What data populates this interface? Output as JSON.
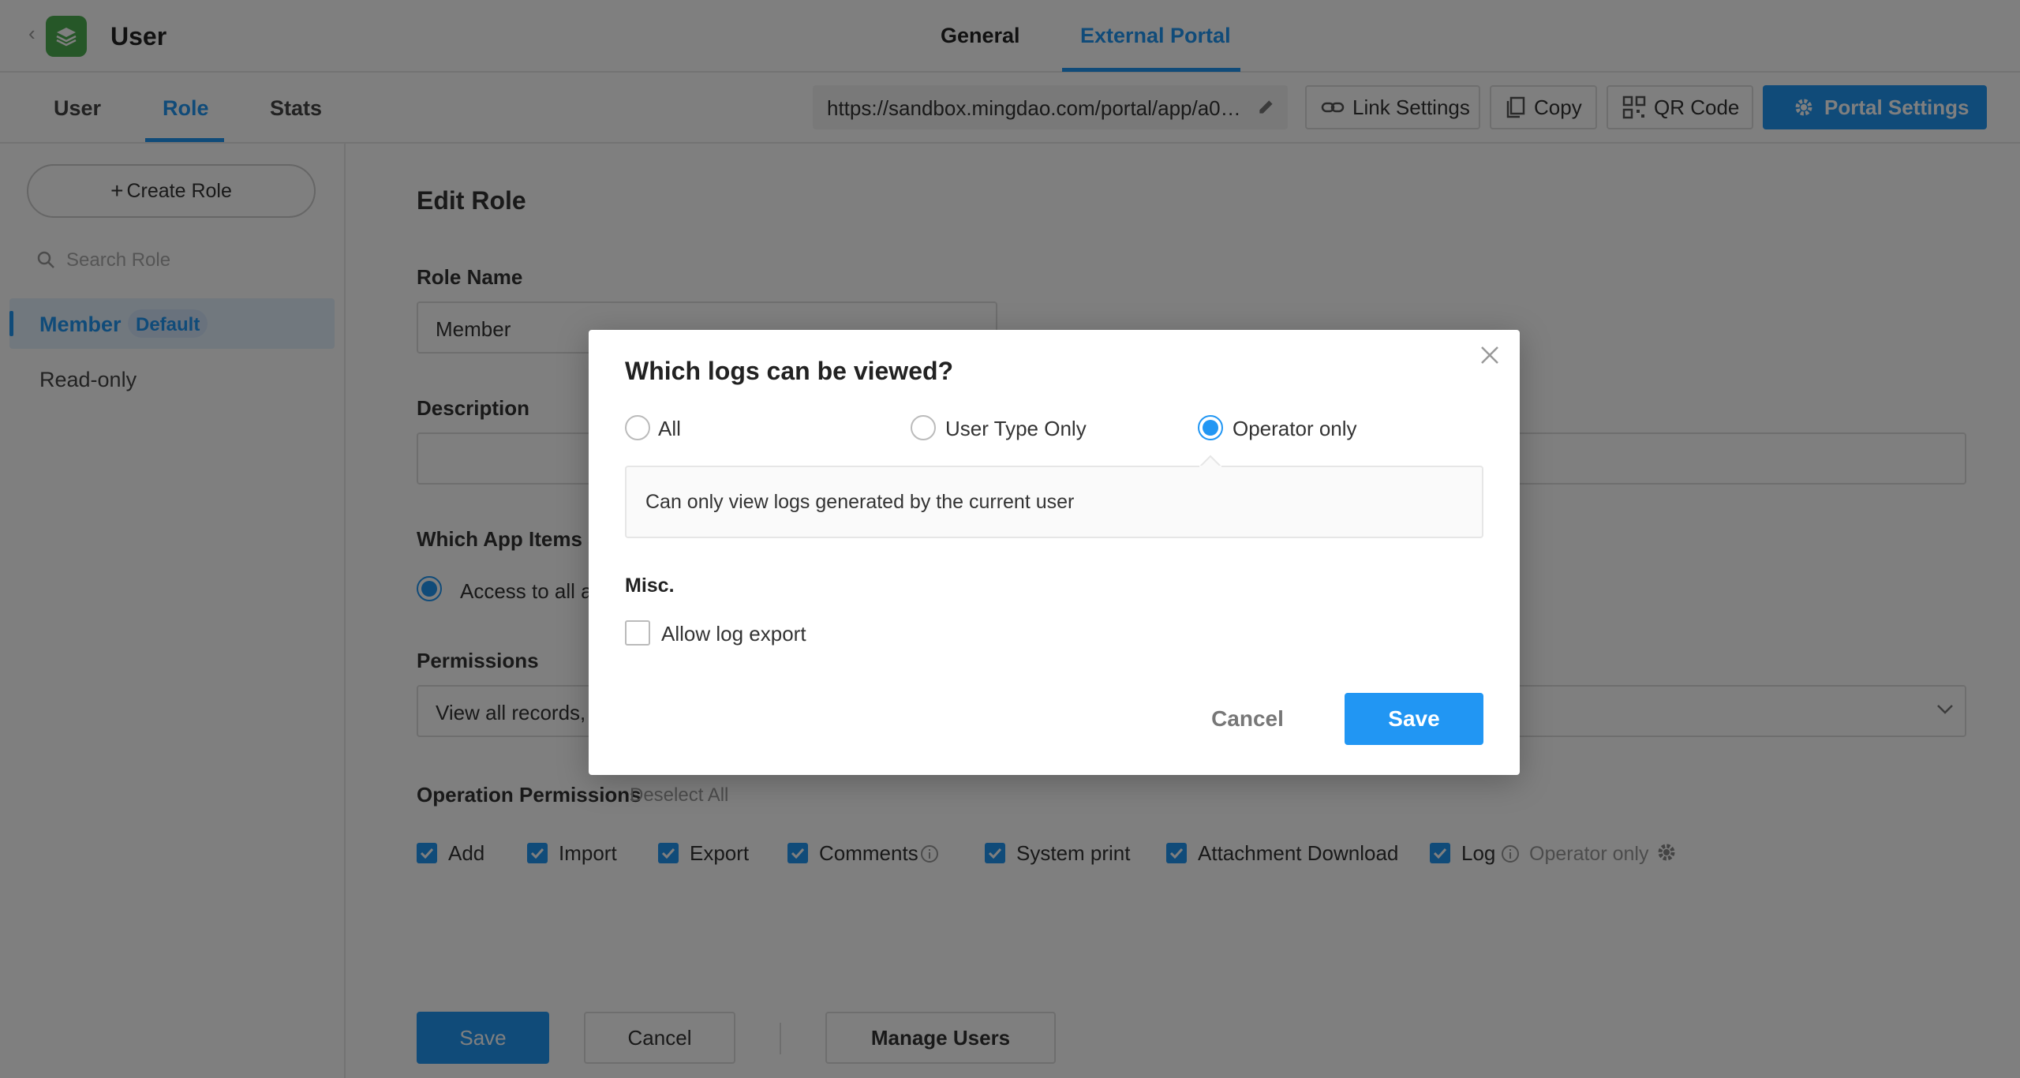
{
  "header": {
    "app_title": "User",
    "tabs": [
      {
        "label": "General",
        "active": false
      },
      {
        "label": "External Portal",
        "active": true
      }
    ]
  },
  "subheader": {
    "tabs": [
      {
        "label": "User",
        "active": false
      },
      {
        "label": "Role",
        "active": true
      },
      {
        "label": "Stats",
        "active": false
      }
    ],
    "portal_url": "https://sandbox.mingdao.com/portal/app/a0…",
    "link_settings_label": "Link Settings",
    "copy_label": "Copy",
    "qr_code_label": "QR Code",
    "portal_settings_label": "Portal Settings"
  },
  "sidebar": {
    "create_role_label": "Create Role",
    "search_placeholder": "Search Role",
    "roles": [
      {
        "name": "Member",
        "badge": "Default",
        "active": true
      },
      {
        "name": "Read-only",
        "badge": "",
        "active": false
      }
    ]
  },
  "edit_role": {
    "title": "Edit Role",
    "role_name_label": "Role Name",
    "role_name_value": "Member",
    "description_label": "Description",
    "description_value": "",
    "app_items_label": "Which App Items a",
    "app_items_option": "Access to all a",
    "permissions_label": "Permissions",
    "permissions_value": "View all records,",
    "operation_permissions_label": "Operation Permissions",
    "deselect_all_label": "Deselect All",
    "operations": [
      {
        "label": "Add",
        "checked": true
      },
      {
        "label": "Import",
        "checked": true
      },
      {
        "label": "Export",
        "checked": true
      },
      {
        "label": "Comments",
        "checked": true
      },
      {
        "label": "System print",
        "checked": true
      },
      {
        "label": "Attachment Download",
        "checked": true
      },
      {
        "label": "Log",
        "checked": true
      }
    ],
    "log_scope_text": "Operator only",
    "save_label": "Save",
    "cancel_label": "Cancel",
    "manage_users_label": "Manage Users"
  },
  "modal": {
    "title": "Which logs can be viewed?",
    "options": [
      {
        "label": "All",
        "selected": false
      },
      {
        "label": "User Type Only",
        "selected": false
      },
      {
        "label": "Operator only",
        "selected": true
      }
    ],
    "description": "Can only view logs generated by the current user",
    "misc_label": "Misc.",
    "allow_export_label": "Allow log export",
    "allow_export_checked": false,
    "cancel_label": "Cancel",
    "save_label": "Save"
  },
  "colors": {
    "accent": "#2196f3",
    "app_logo": "#4caf50"
  }
}
